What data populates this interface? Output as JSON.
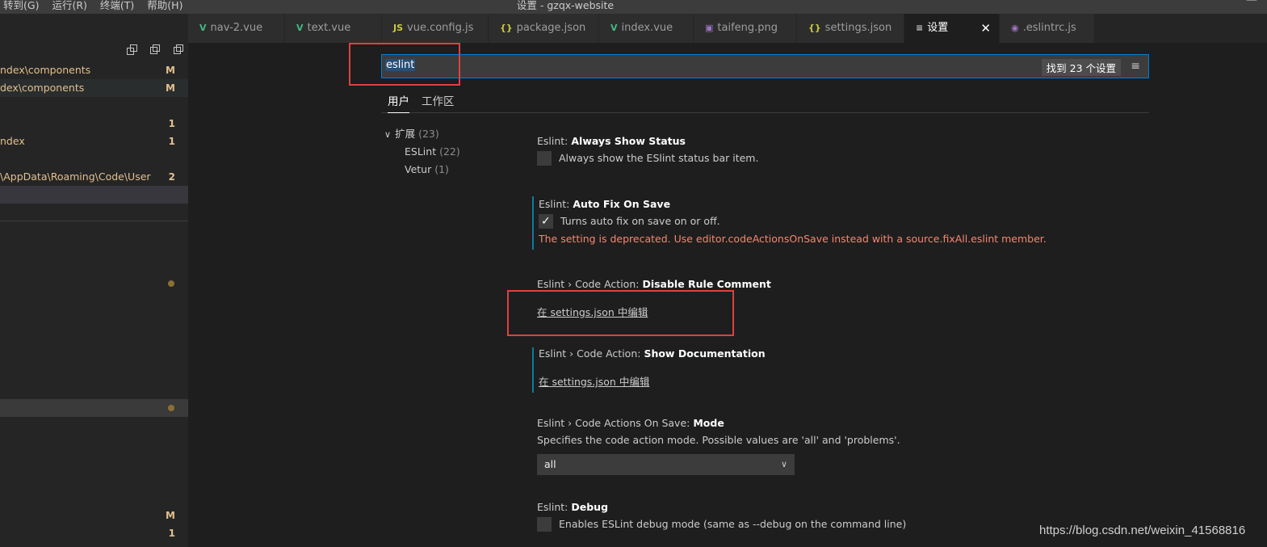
{
  "window": {
    "title": "设置 - gzqx-website",
    "menu": [
      "转到(G)",
      "运行(R)",
      "终端(T)",
      "帮助(H)"
    ]
  },
  "sidebar": {
    "rows": [
      {
        "label": "ndex\\components",
        "badge": "M"
      },
      {
        "label": "dex\\components",
        "badge": "M"
      },
      {
        "label": "",
        "badge": "1"
      },
      {
        "label": "ndex",
        "badge": "1"
      },
      {
        "label": "\\AppData\\Roaming\\Code\\User",
        "badge": "2"
      },
      {
        "label": "",
        "badge": "M"
      },
      {
        "label": "",
        "badge": "1"
      }
    ]
  },
  "tabs": [
    {
      "icon": "V",
      "icon_name": "vue-icon",
      "label": "nav-2.vue"
    },
    {
      "icon": "V",
      "icon_name": "vue-icon",
      "label": "text.vue"
    },
    {
      "icon": "JS",
      "icon_name": "js-icon",
      "label": "vue.config.js"
    },
    {
      "icon": "{}",
      "icon_name": "json-icon",
      "label": "package.json"
    },
    {
      "icon": "V",
      "icon_name": "vue-icon",
      "label": "index.vue"
    },
    {
      "icon": "▣",
      "icon_name": "image-icon",
      "label": "taifeng.png"
    },
    {
      "icon": "{}",
      "icon_name": "json-icon",
      "label": "settings.json"
    },
    {
      "icon": "≡",
      "icon_name": "settings-list-icon",
      "label": "设置",
      "close": "✕"
    },
    {
      "icon": "◉",
      "icon_name": "eslint-icon",
      "label": ".eslintrc.js"
    }
  ],
  "search": {
    "query": "eslint",
    "result_count": "找到 23 个设置",
    "filter_icon": "filter-icon"
  },
  "settings_tabs": [
    "用户",
    "工作区"
  ],
  "toc": {
    "group": "扩展",
    "group_count": "(23)",
    "items": [
      {
        "label": "ESLint",
        "count": "(22)"
      },
      {
        "label": "Vetur",
        "count": "(1)"
      }
    ]
  },
  "settings": [
    {
      "prefix": "Eslint: ",
      "name": "Always Show Status",
      "desc": "Always show the ESlint status bar item.",
      "checked": false
    },
    {
      "prefix": "Eslint: ",
      "name": "Auto Fix On Save",
      "desc": "Turns auto fix on save on or off.",
      "checked": true,
      "deprecation": "The setting is deprecated. Use editor.codeActionsOnSave instead with a source.fixAll.eslint member."
    },
    {
      "prefix": "Eslint › Code Action: ",
      "name": "Disable Rule Comment",
      "link": "在 settings.json 中编辑"
    },
    {
      "prefix": "Eslint › Code Action: ",
      "name": "Show Documentation",
      "link": "在 settings.json 中编辑"
    },
    {
      "prefix": "Eslint › Code Actions On Save: ",
      "name": "Mode",
      "desc": "Specifies the code action mode. Possible values are 'all' and 'problems'.",
      "select_value": "all"
    },
    {
      "prefix": "Eslint: ",
      "name": "Debug",
      "desc": "Enables ESLint debug mode (same as --debug on the command line)",
      "checked": false
    }
  ],
  "watermark": "https://blog.csdn.net/weixin_41568816",
  "colors": {
    "accent": "#007fd4",
    "deprecation": "#f48771",
    "git_modified": "#e2c08d",
    "annotation_red": "#e04040"
  }
}
